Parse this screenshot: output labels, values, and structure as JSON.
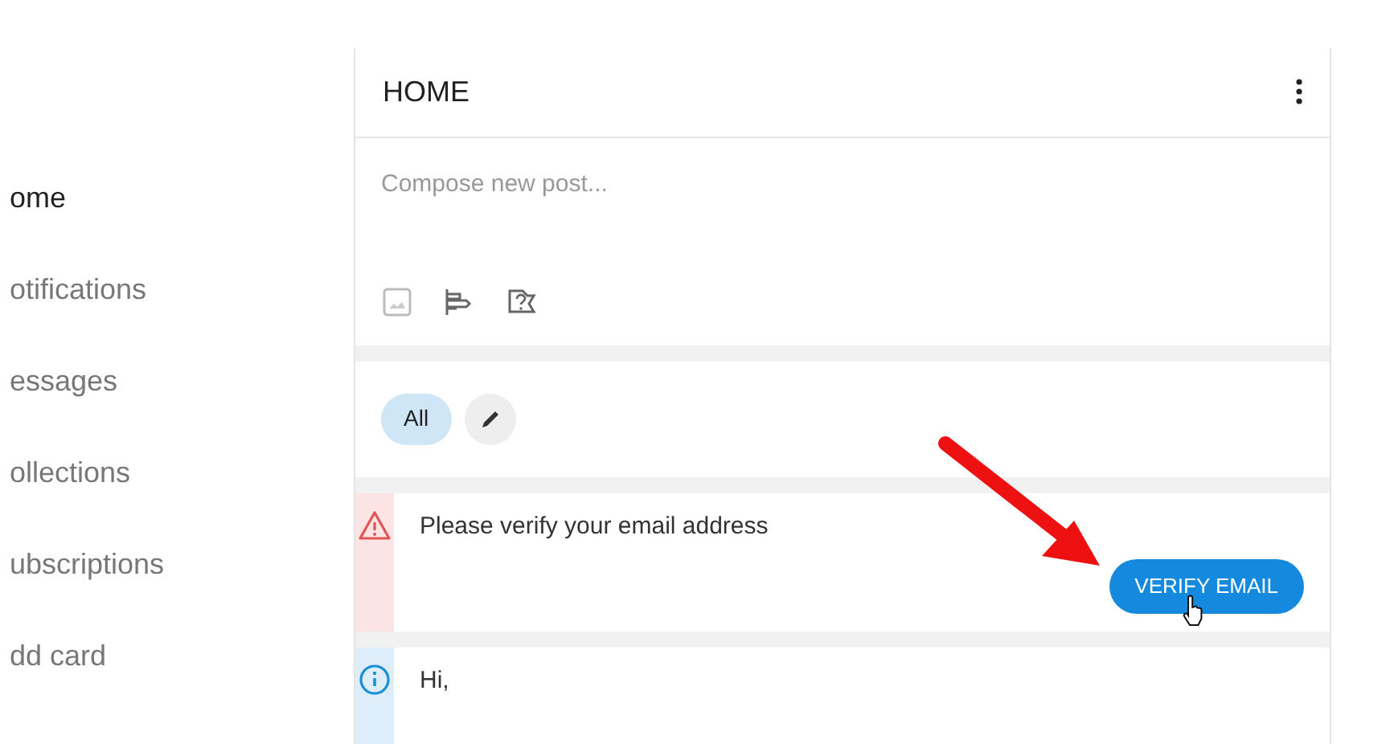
{
  "sidebar": {
    "items": [
      {
        "label": "ome",
        "selected": true
      },
      {
        "label": "otifications",
        "selected": false
      },
      {
        "label": "essages",
        "selected": false
      },
      {
        "label": "ollections",
        "selected": false
      },
      {
        "label": "ubscriptions",
        "selected": false
      },
      {
        "label": "dd card",
        "selected": false
      }
    ]
  },
  "header": {
    "title": "HOME"
  },
  "composer": {
    "placeholder": "Compose new post..."
  },
  "filters": [
    {
      "label": "All",
      "selected": true
    }
  ],
  "notices": [
    {
      "kind": "warning",
      "text": "Please verify your email address",
      "button": "VERIFY EMAIL"
    },
    {
      "kind": "info",
      "text": "Hi,"
    }
  ]
}
